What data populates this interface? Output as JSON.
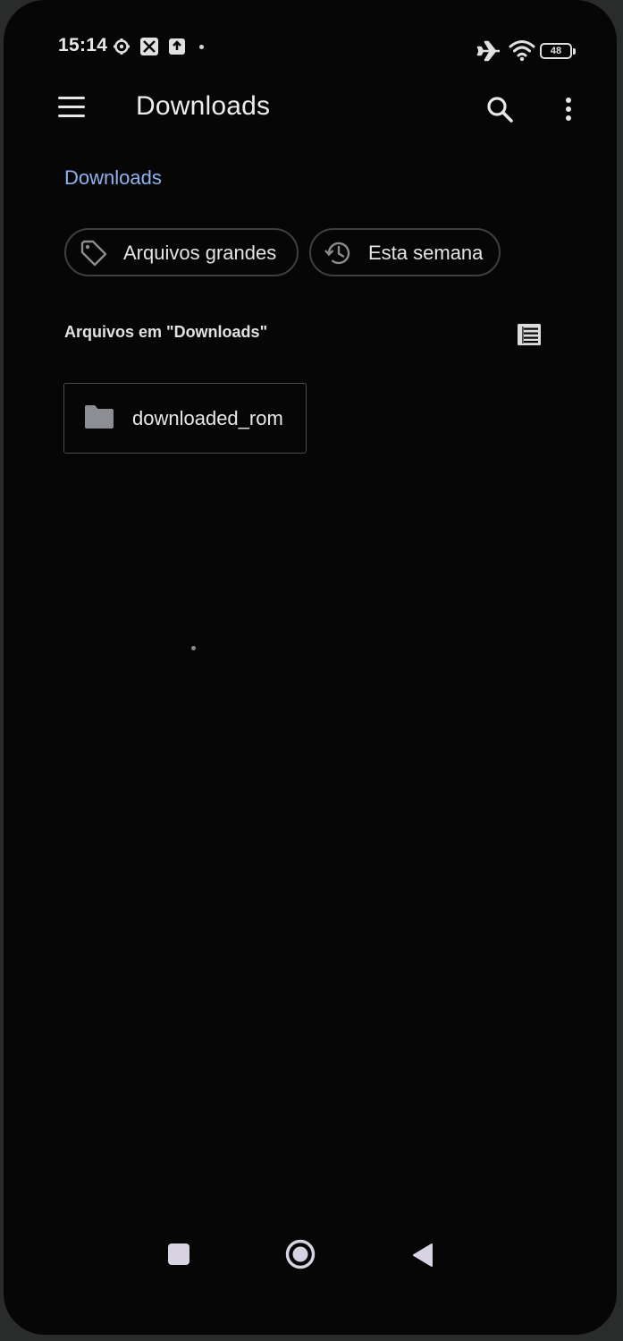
{
  "status_bar": {
    "time": "15:14",
    "battery_level": "48",
    "icons": [
      "settings-gear-icon",
      "app-notification-icon",
      "upload-notification-icon",
      "notification-dot",
      "airplane-mode-icon",
      "wifi-icon",
      "battery-icon"
    ]
  },
  "app_bar": {
    "title": "Downloads",
    "icons": [
      "menu-icon",
      "search-icon",
      "more-vert-icon"
    ]
  },
  "breadcrumb": {
    "current": "Downloads"
  },
  "filter_chips": [
    {
      "label": "Arquivos grandes",
      "icon": "tag-icon"
    },
    {
      "label": "Esta semana",
      "icon": "history-icon"
    }
  ],
  "files_section": {
    "label": "Arquivos em \"Downloads\"",
    "view_toggle_icon": "list-view-icon"
  },
  "items": [
    {
      "type": "folder",
      "name": "downloaded_rom",
      "icon": "folder-icon"
    }
  ],
  "nav_bar": {
    "icons": [
      "recents-square-icon",
      "home-circle-icon",
      "back-triangle-icon"
    ]
  },
  "colors": {
    "background": "#060606",
    "accent": "#8fb4f0",
    "text": "#e8e8e8",
    "chip_border": "#3d3f42"
  }
}
